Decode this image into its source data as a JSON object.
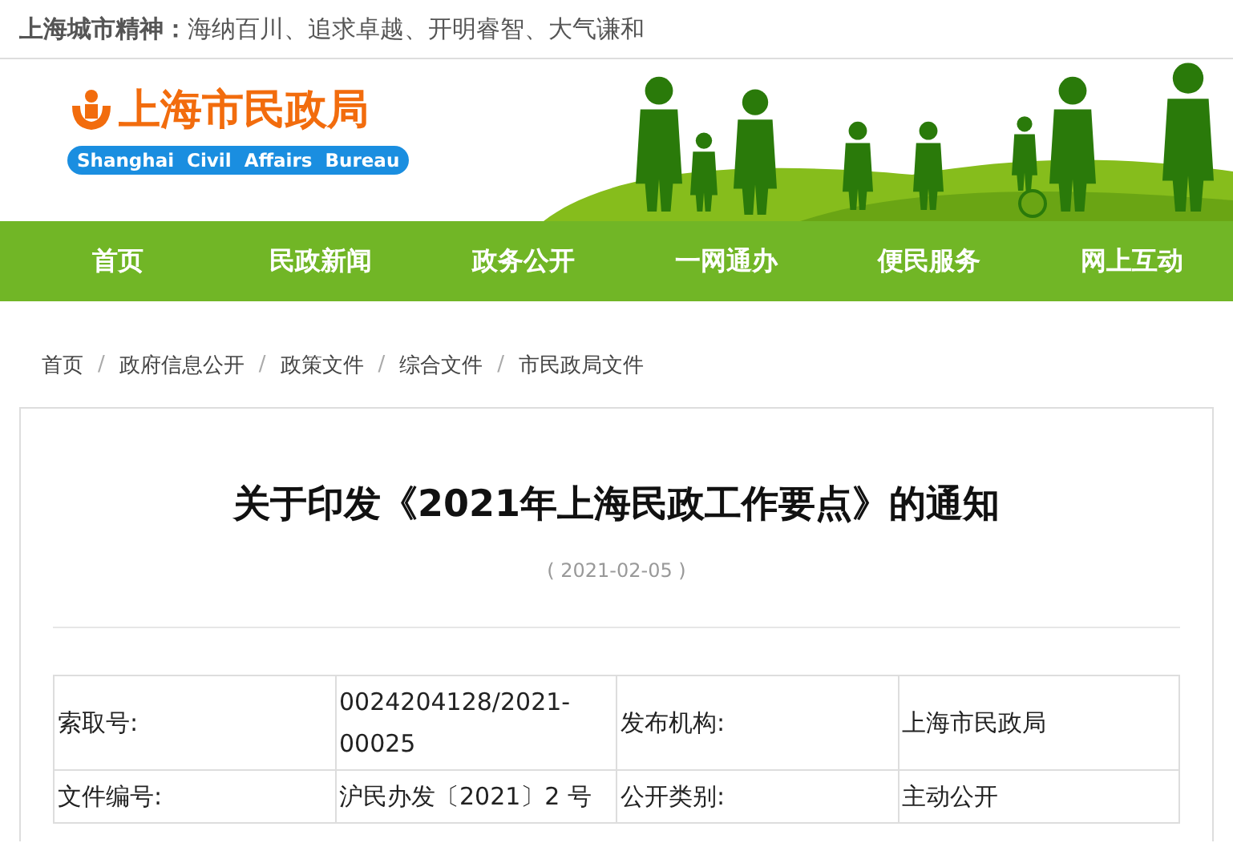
{
  "top_bar": {
    "text": "**上海城市精神：**海纳百川、追求卓越、开明睿智、大气谦和"
  },
  "logo": {
    "name": "上海市民政局",
    "english": "Shanghai  Civil  Affairs  Bureau"
  },
  "nav": [
    {
      "label": "首页"
    },
    {
      "label": "民政新闻"
    },
    {
      "label": "政务公开"
    },
    {
      "label": "一网通办"
    },
    {
      "label": "便民服务"
    },
    {
      "label": "网上互动"
    }
  ],
  "breadcrumb": {
    "separator": "/",
    "items": [
      "首页",
      "政府信息公开",
      "政策文件",
      "综合文件",
      "市民政局文件"
    ]
  },
  "article": {
    "title": "关于印发《2021年上海民政工作要点》的通知",
    "date": "( 2021-02-05 )",
    "info_table": [
      [
        "索取号:",
        "0024204128/2021-00025",
        "发布机构:",
        "上海市民政局"
      ],
      [
        "文件编号:",
        "沪民办发〔2021〕2 号",
        "公开类别:",
        "主动公开"
      ]
    ]
  }
}
